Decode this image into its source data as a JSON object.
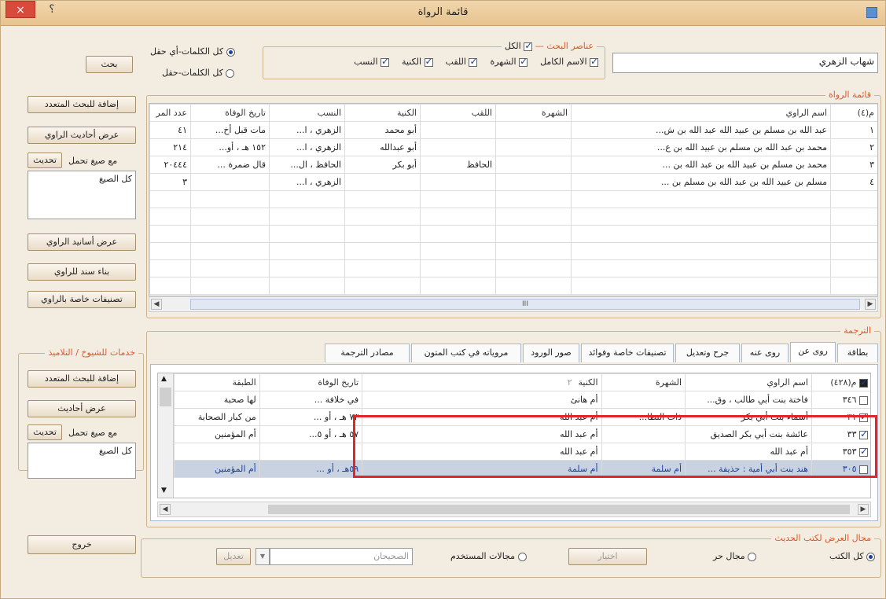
{
  "window": {
    "title": "قائمة الرواة",
    "close": "×",
    "help": "؟"
  },
  "search": {
    "value": "شهاب الزهري",
    "button": "بحث",
    "elements_group_title": "عناصر البحث",
    "all_label": "الكل",
    "fields": [
      {
        "label": "الاسم الكامل",
        "checked": true
      },
      {
        "label": "الشهرة",
        "checked": true
      },
      {
        "label": "اللقب",
        "checked": true
      },
      {
        "label": "الكنية",
        "checked": true
      },
      {
        "label": "النسب",
        "checked": true
      }
    ],
    "mode_any": "كل الكلمات-أي حقل",
    "mode_field": "كل الكلمات-حقل"
  },
  "narrators": {
    "group_title": "قائمة الرواة",
    "columns": [
      "م(٤)",
      "اسم الراوي",
      "الشهرة",
      "اللقب",
      "الكنية",
      "النسب",
      "تاريخ الوفاة",
      "عدد المر"
    ],
    "rows": [
      [
        "١",
        "عبد الله بن مسلم بن عبيد الله عبد الله بن ش...",
        "",
        "",
        "أبو محمد",
        "الزهري ، ا...",
        "مات قبل أخ...",
        "٤١"
      ],
      [
        "٢",
        "محمد بن عبد الله بن مسلم بن عبيد الله بن ع...",
        "",
        "",
        "أبو عبدالله",
        "الزهري ، ا...",
        "١٥٢ هـ ، أو...",
        "٢١٤"
      ],
      [
        "٣",
        "محمد بن مسلم بن عبيد الله بن عبد الله بن ...",
        "",
        "الحافظ",
        "أبو بكر",
        "الحافظ ، ال...",
        "قال ضمرة ...",
        "٢٠٤٤٤"
      ],
      [
        "٤",
        "مسلم بن عبيد الله بن عبد الله بن مسلم بن ...",
        "",
        "",
        "",
        "الزهري ، ا...",
        "",
        "٣"
      ]
    ],
    "scroll_mark": "III"
  },
  "side_top": {
    "add_search": "إضافة للبحث المتعدد",
    "show_hadith": "عرض أحاديث الراوي",
    "formula_label": "مع صيغ تحمل",
    "update": "تحديث",
    "all_formulas": "كل الصيغ",
    "show_chains": "عرض أسانيد الراوي",
    "build_chain": "بناء سند للراوي",
    "special_class": "تصنيفات خاصة بالراوي"
  },
  "translation": {
    "group_title": "الترجمة",
    "tabs": [
      "بطاقة",
      "روى عن",
      "روى عنه",
      "جرح وتعديل",
      "تصنيفات خاصة وفوائد",
      "صور الورود",
      "مروياته في كتب المتون",
      "مصادر الترجمة"
    ],
    "active_tab": "روى عن",
    "columns": [
      "م(٤٢٨)",
      "اسم الراوي",
      "الشهرة",
      "الكنية",
      "تاريخ الوفاة",
      "الطبقة"
    ],
    "col_flag": "٢",
    "rows": [
      {
        "n": "٣٤٦",
        "name": "فاختة بنت أبي طالب ، وق...",
        "fame": "",
        "kunya": "أم هانئ",
        "death": "في خلافة ...",
        "class": "لها صحبة",
        "checked": false,
        "style": "normal"
      },
      {
        "n": "٣١",
        "name": "أسماء بنت أبي بكر",
        "fame": "ذات النطا...",
        "kunya": "أم عبد الله",
        "death": "٧٣ هـ ، أو ...",
        "class": "من كبار الصحابة",
        "checked": true,
        "style": "normal"
      },
      {
        "n": "٣٣",
        "name": "عائشة بنت أبي بكر الصديق",
        "fame": "",
        "kunya": "أم عبد الله",
        "death": "٥٧ هـ ، أو ٥...",
        "class": "أم المؤمنين",
        "checked": true,
        "style": "normal"
      },
      {
        "n": "٣٥٣",
        "name": "أم عبد الله",
        "fame": "",
        "kunya": "أم عبد الله",
        "death": "",
        "class": "",
        "checked": true,
        "style": "normal"
      },
      {
        "n": "٣٠٥",
        "name": "هند بنت أبي أمية : حذيفة ...",
        "fame": "أم سلمة",
        "kunya": "أم سلمة",
        "death": "٥٩هـ ، أو ...",
        "class": "أم المؤمنين",
        "checked": false,
        "style": "selected"
      }
    ]
  },
  "side_bottom": {
    "group_title": "خدمات للشيوخ / التلاميذ",
    "add_search": "إضافة للبحث المتعدد",
    "show_hadith": "عرض أحاديث",
    "formula_label": "مع صيغ تحمل",
    "update": "تحديث",
    "all_formulas": "كل الصيغ"
  },
  "display": {
    "group_title": "مجال العرض لكتب الحديث",
    "all_books": "كل الكتب",
    "free_range": "مجال حر",
    "choose": "اختيار",
    "user_ranges": "مجالات المستخدم",
    "sahihain": "الصحيحان",
    "edit": "تعديل"
  },
  "exit": "خروج",
  "colors": {
    "highlight_box": "#e0262a",
    "accent_title": "#e0582b",
    "selected_row": "#c9d2e0"
  }
}
